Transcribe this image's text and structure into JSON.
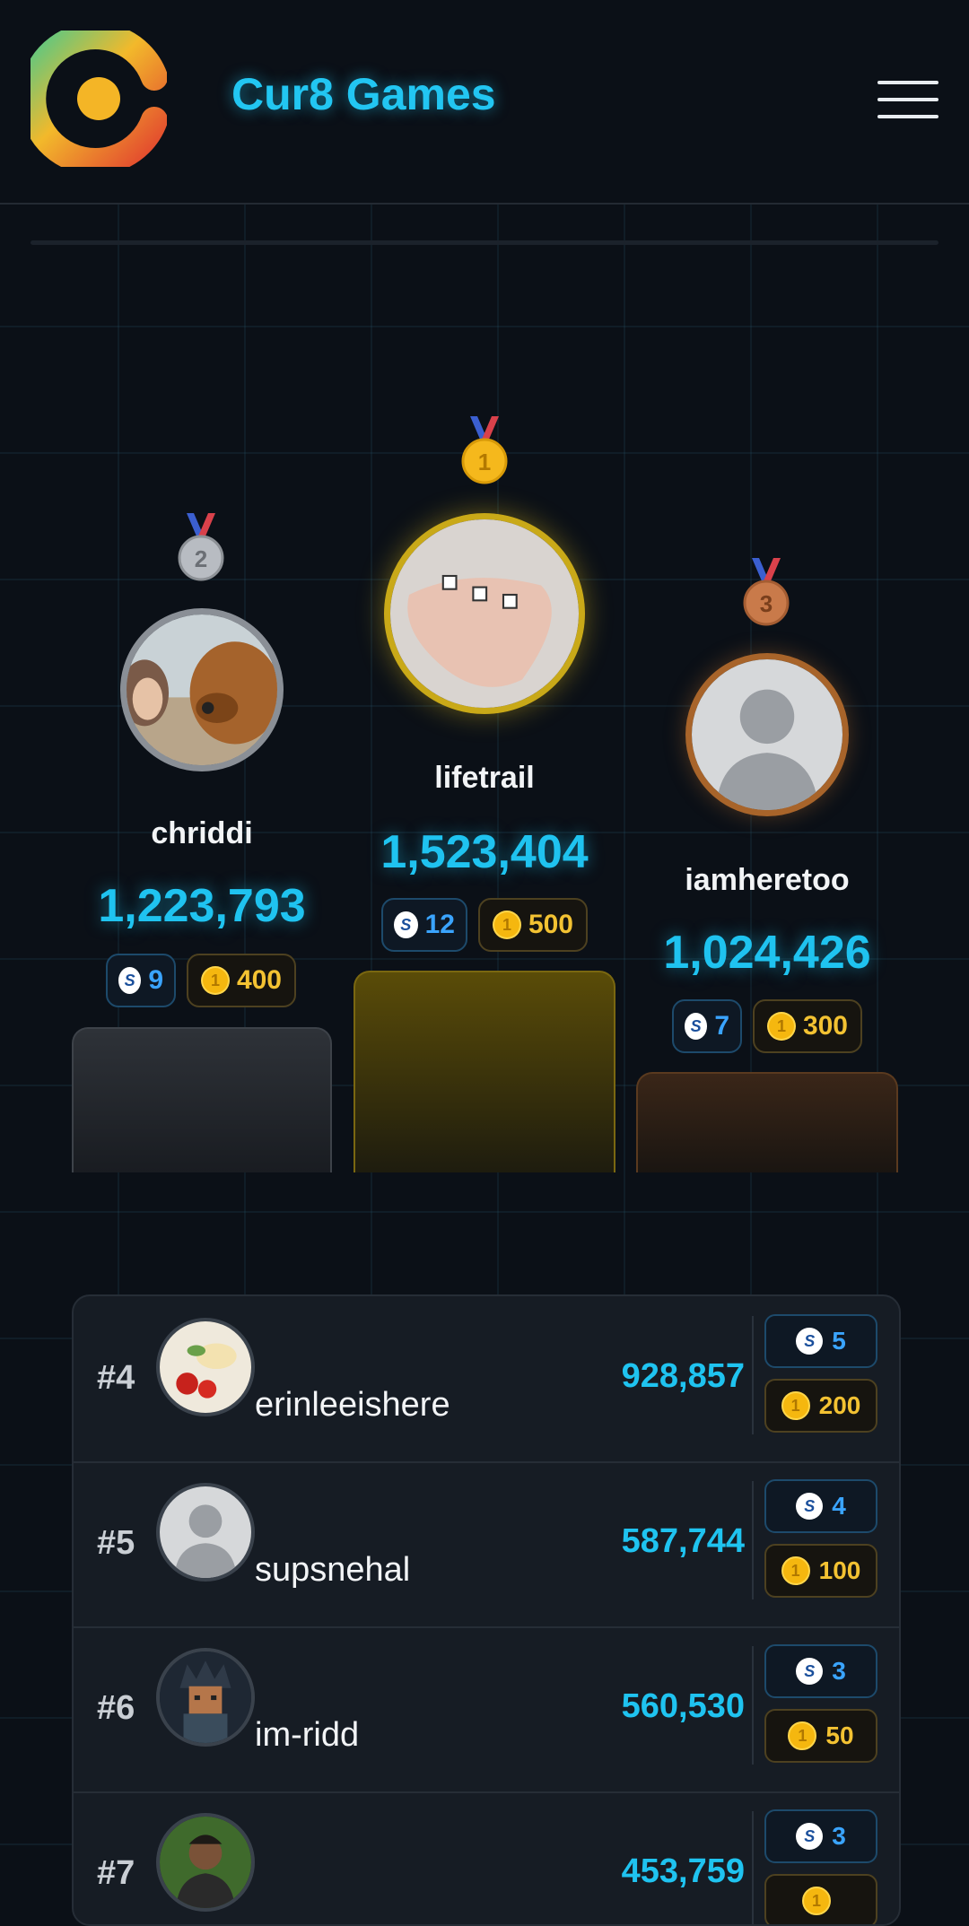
{
  "header": {
    "brand": "Cur8 Games",
    "logo_icon": "cur8-logo-icon",
    "menu_icon": "hamburger-menu-icon"
  },
  "colors": {
    "accent": "#1fc3f0",
    "background": "#0b1017",
    "gold": "#d4b21a",
    "silver": "#8a8f96",
    "bronze": "#b06a2a",
    "steem_blue": "#3aa4ff",
    "coin_gold": "#f3c232"
  },
  "podium": [
    {
      "place": 2,
      "medal_icon": "silver-medal-icon",
      "name": "chriddi",
      "score": "1,223,793",
      "steem": "9",
      "coins": "400"
    },
    {
      "place": 1,
      "medal_icon": "gold-medal-icon",
      "name": "lifetrail",
      "score": "1,523,404",
      "steem": "12",
      "coins": "500"
    },
    {
      "place": 3,
      "medal_icon": "bronze-medal-icon",
      "name": "iamheretoo",
      "score": "1,024,426",
      "steem": "7",
      "coins": "300"
    }
  ],
  "leaderboard": [
    {
      "rank": "#4",
      "name": "erinleeishere",
      "score": "928,857",
      "steem": "5",
      "coins": "200"
    },
    {
      "rank": "#5",
      "name": "supsnehal",
      "score": "587,744",
      "steem": "4",
      "coins": "100"
    },
    {
      "rank": "#6",
      "name": "im-ridd",
      "score": "560,530",
      "steem": "3",
      "coins": "50"
    },
    {
      "rank": "#7",
      "name": "",
      "score": "453,759",
      "steem": "3",
      "coins": ""
    }
  ]
}
